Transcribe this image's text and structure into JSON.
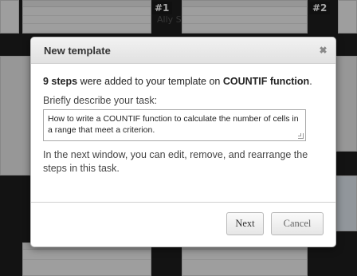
{
  "background": {
    "thumb_labels": [
      "#1",
      "#2"
    ],
    "ghost_text": "Ally S"
  },
  "dialog": {
    "title": "New template",
    "close_glyph": "✖",
    "intro_count": "9 steps",
    "intro_middle": " were added to your template on ",
    "intro_function": "COUNTIF function",
    "intro_end": ".",
    "describe_label": "Briefly describe your task:",
    "task_description": "How to write a COUNTIF function to calculate the number of cells in a range that meet a criterion.",
    "note": "In the next window, you can edit, remove, and rearrange the steps in this task.",
    "next_label": "Next",
    "cancel_label": "Cancel"
  },
  "colors": {
    "dialog_bg": "#ffffff",
    "header_bg": "#e8e8e8",
    "backdrop": "#2b2b2b"
  }
}
